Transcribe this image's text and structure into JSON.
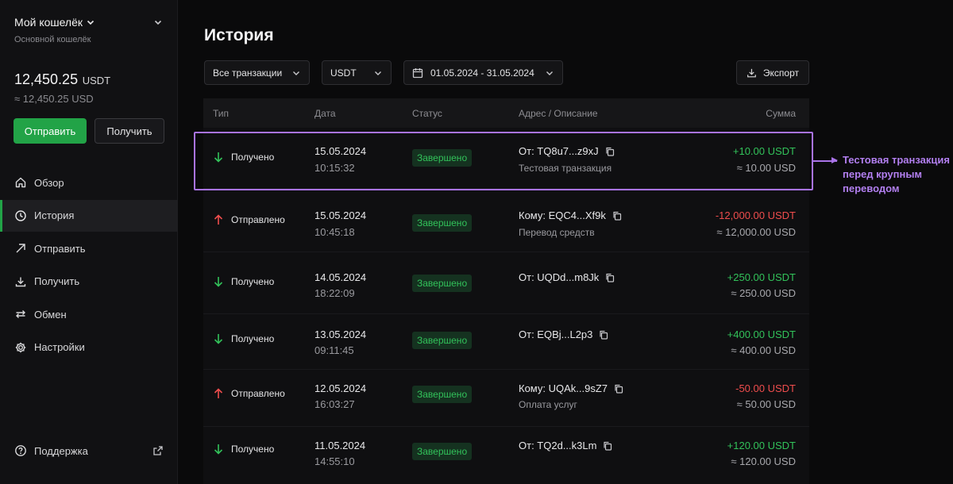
{
  "wallet": {
    "name": "Мой кошелёк",
    "subtitle": "Основной кошелёк",
    "balance": "12,450.25",
    "balance_currency": "USDT",
    "balance_approx": "≈ 12,450.25 USD",
    "send_label": "Отправить",
    "receive_label": "Получить"
  },
  "nav": {
    "items": [
      {
        "label": "Обзор",
        "icon": "home-icon"
      },
      {
        "label": "История",
        "icon": "clock-icon",
        "active": true
      },
      {
        "label": "Отправить",
        "icon": "send-arrow-icon"
      },
      {
        "label": "Получить",
        "icon": "download-icon"
      },
      {
        "label": "Обмен",
        "icon": "swap-icon"
      },
      {
        "label": "Настройки",
        "icon": "gear-icon"
      }
    ],
    "support_label": "Поддержка"
  },
  "page": {
    "title": "История"
  },
  "filters": {
    "type": "Все транзакции",
    "currency": "USDT",
    "date_range": "01.05.2024 - 31.05.2024",
    "export_label": "Экспорт"
  },
  "table": {
    "headers": {
      "type": "Тип",
      "date": "Дата",
      "status": "Статус",
      "address": "Адрес / Описание",
      "amount": "Сумма"
    },
    "rows": [
      {
        "direction": "in",
        "type": "Получено",
        "date": "15.05.2024",
        "time": "10:15:32",
        "status": "Завершено",
        "address": "От: TQ8u7...z9xJ",
        "description": "Тестовая транзакция",
        "amount": "+10.00 USDT",
        "approx": "≈ 10.00 USD"
      },
      {
        "direction": "out",
        "type": "Отправлено",
        "date": "15.05.2024",
        "time": "10:45:18",
        "status": "Завершено",
        "address": "Кому: EQC4...Xf9k",
        "description": "Перевод средств",
        "amount": "-12,000.00 USDT",
        "approx": "≈ 12,000.00 USD"
      },
      {
        "direction": "in",
        "type": "Получено",
        "date": "14.05.2024",
        "time": "18:22:09",
        "status": "Завершено",
        "address": "От: UQDd...m8Jk",
        "description": "",
        "amount": "+250.00 USDT",
        "approx": "≈ 250.00 USD"
      },
      {
        "direction": "in",
        "type": "Получено",
        "date": "13.05.2024",
        "time": "09:11:45",
        "status": "Завершено",
        "address": "От: EQBj...L2p3",
        "description": "",
        "amount": "+400.00 USDT",
        "approx": "≈ 400.00 USD"
      },
      {
        "direction": "out",
        "type": "Отправлено",
        "date": "12.05.2024",
        "time": "16:03:27",
        "status": "Завершено",
        "address": "Кому: UQAk...9sZ7",
        "description": "Оплата услуг",
        "amount": "-50.00 USDT",
        "approx": "≈ 50.00 USD"
      },
      {
        "direction": "in",
        "type": "Получено",
        "date": "11.05.2024",
        "time": "14:55:10",
        "status": "Завершено",
        "address": "От: TQ2d...k3Lm",
        "description": "",
        "amount": "+120.00 USDT",
        "approx": "≈ 120.00 USD"
      }
    ]
  },
  "annotation": {
    "text": "Тестовая транзакция перед крупным переводом"
  },
  "colors": {
    "accent_green": "#22a347",
    "positive": "#32c25a",
    "negative": "#ef4d4d",
    "highlight_purple": "#a973e8"
  }
}
